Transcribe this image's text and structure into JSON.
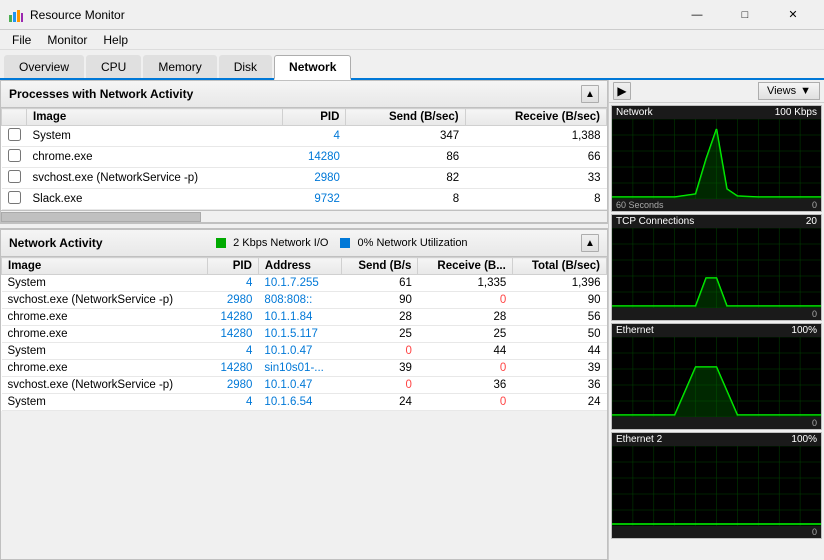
{
  "titlebar": {
    "title": "Resource Monitor",
    "icon": "📊",
    "min_label": "—",
    "max_label": "□",
    "close_label": "✕"
  },
  "menubar": {
    "items": [
      "File",
      "Monitor",
      "Help"
    ]
  },
  "tabs": {
    "items": [
      "Overview",
      "CPU",
      "Memory",
      "Disk",
      "Network"
    ],
    "active": "Network"
  },
  "processes_section": {
    "title": "Processes with Network Activity",
    "columns": [
      "Image",
      "PID",
      "Send (B/sec)",
      "Receive (B/sec)"
    ],
    "rows": [
      {
        "image": "System",
        "pid": "4",
        "send": "347",
        "receive": "1,388"
      },
      {
        "image": "chrome.exe",
        "pid": "14280",
        "send": "86",
        "receive": "66"
      },
      {
        "image": "svchost.exe (NetworkService -p)",
        "pid": "2980",
        "send": "82",
        "receive": "33"
      },
      {
        "image": "Slack.exe",
        "pid": "9732",
        "send": "8",
        "receive": "8"
      }
    ]
  },
  "network_activity_section": {
    "title": "Network Activity",
    "indicator1_label": "2 Kbps Network I/O",
    "indicator1_color": "#00aa00",
    "indicator2_label": "0% Network Utilization",
    "indicator2_color": "#0078d7",
    "columns": [
      "Image",
      "PID",
      "Address",
      "Send (B/s",
      "Receive (B...",
      "Total (B/sec)"
    ],
    "rows": [
      {
        "image": "System",
        "pid": "4",
        "address": "10.1.7.255",
        "send": "61",
        "receive": "1,335",
        "total": "1,396",
        "send_color": false,
        "receive_color": false
      },
      {
        "image": "svchost.exe (NetworkService -p)",
        "pid": "2980",
        "address": "808:808::",
        "send": "90",
        "receive": "0",
        "total": "90",
        "send_color": false,
        "receive_color": true
      },
      {
        "image": "chrome.exe",
        "pid": "14280",
        "address": "10.1.1.84",
        "send": "28",
        "receive": "28",
        "total": "56",
        "send_color": false,
        "receive_color": false
      },
      {
        "image": "chrome.exe",
        "pid": "14280",
        "address": "10.1.5.117",
        "send": "25",
        "receive": "25",
        "total": "50",
        "send_color": false,
        "receive_color": false
      },
      {
        "image": "System",
        "pid": "4",
        "address": "10.1.0.47",
        "send": "0",
        "receive": "44",
        "total": "44",
        "send_color": true,
        "receive_color": false
      },
      {
        "image": "chrome.exe",
        "pid": "14280",
        "address": "sin10s01-...",
        "send": "39",
        "receive": "0",
        "total": "39",
        "send_color": false,
        "receive_color": true
      },
      {
        "image": "svchost.exe (NetworkService -p)",
        "pid": "2980",
        "address": "10.1.0.47",
        "send": "0",
        "receive": "36",
        "total": "36",
        "send_color": true,
        "receive_color": false
      },
      {
        "image": "System",
        "pid": "4",
        "address": "10.1.6.54",
        "send": "24",
        "receive": "0",
        "total": "24",
        "send_color": false,
        "receive_color": true
      }
    ]
  },
  "right_panel": {
    "expand_btn": "▶",
    "views_label": "Views",
    "graphs": [
      {
        "title": "Network",
        "scale": "100 Kbps",
        "footer_left": "60 Seconds",
        "footer_right": "0"
      },
      {
        "title": "TCP Connections",
        "scale": "20",
        "footer_left": "",
        "footer_right": "0"
      },
      {
        "title": "Ethernet",
        "scale": "100%",
        "footer_left": "",
        "footer_right": "0"
      },
      {
        "title": "Ethernet 2",
        "scale": "100%",
        "footer_left": "",
        "footer_right": "0"
      }
    ]
  }
}
